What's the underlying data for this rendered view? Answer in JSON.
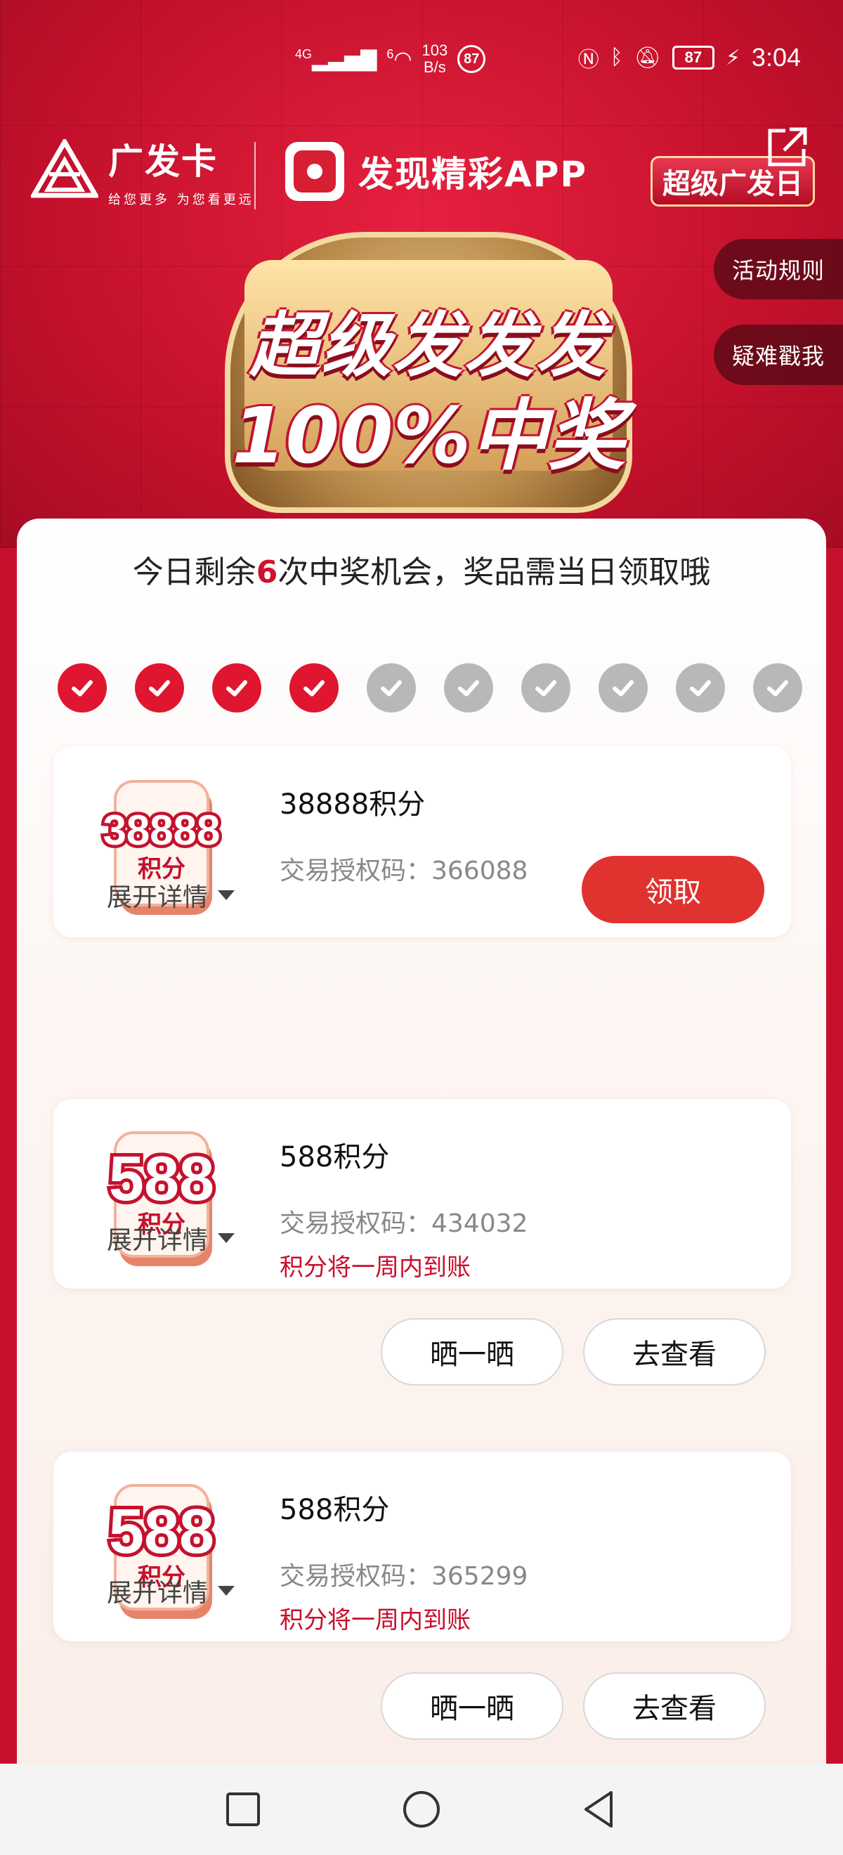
{
  "status_bar": {
    "network": "4G",
    "network2": "6",
    "speed_value": "103",
    "speed_unit": "B/s",
    "notification_count": "87",
    "battery": "87",
    "time": "3:04"
  },
  "header": {
    "bank_name": "广发卡",
    "bank_slogan": "给您更多 为您看更远",
    "app_name": "发现精彩APP",
    "event_badge": "超级广发日",
    "rules_button": "活动规则",
    "help_button": "疑难戳我",
    "title_line1": "超级发发发",
    "title_line2": "100%中奖"
  },
  "chances": {
    "prefix": "今日剩余",
    "count": "6",
    "suffix": "次中奖机会，奖品需当日领取哦",
    "total": 10,
    "used": 4
  },
  "prizes": [
    {
      "art_number": "38888",
      "art_unit": "积分",
      "title": "38888积分",
      "code": "交易授权码：366088",
      "note": "",
      "expand_label": "展开详情",
      "actions": [
        "领取"
      ]
    },
    {
      "art_number": "588",
      "art_unit": "积分",
      "title": "588积分",
      "code": "交易授权码：434032",
      "note": "积分将一周内到账",
      "expand_label": "展开详情",
      "actions": [
        "晒一晒",
        "去查看"
      ]
    },
    {
      "art_number": "588",
      "art_unit": "积分",
      "title": "588积分",
      "code": "交易授权码：365299",
      "note": "积分将一周内到账",
      "expand_label": "展开详情",
      "actions": [
        "晒一晒",
        "去查看"
      ]
    }
  ],
  "colors": {
    "brand_red": "#c8102e",
    "claim_button": "#e0322f",
    "note_red": "#c80f2b"
  },
  "icons": [
    "share-icon",
    "check-icon",
    "caret-down-icon",
    "square-icon",
    "circle-icon",
    "back-triangle-icon"
  ]
}
